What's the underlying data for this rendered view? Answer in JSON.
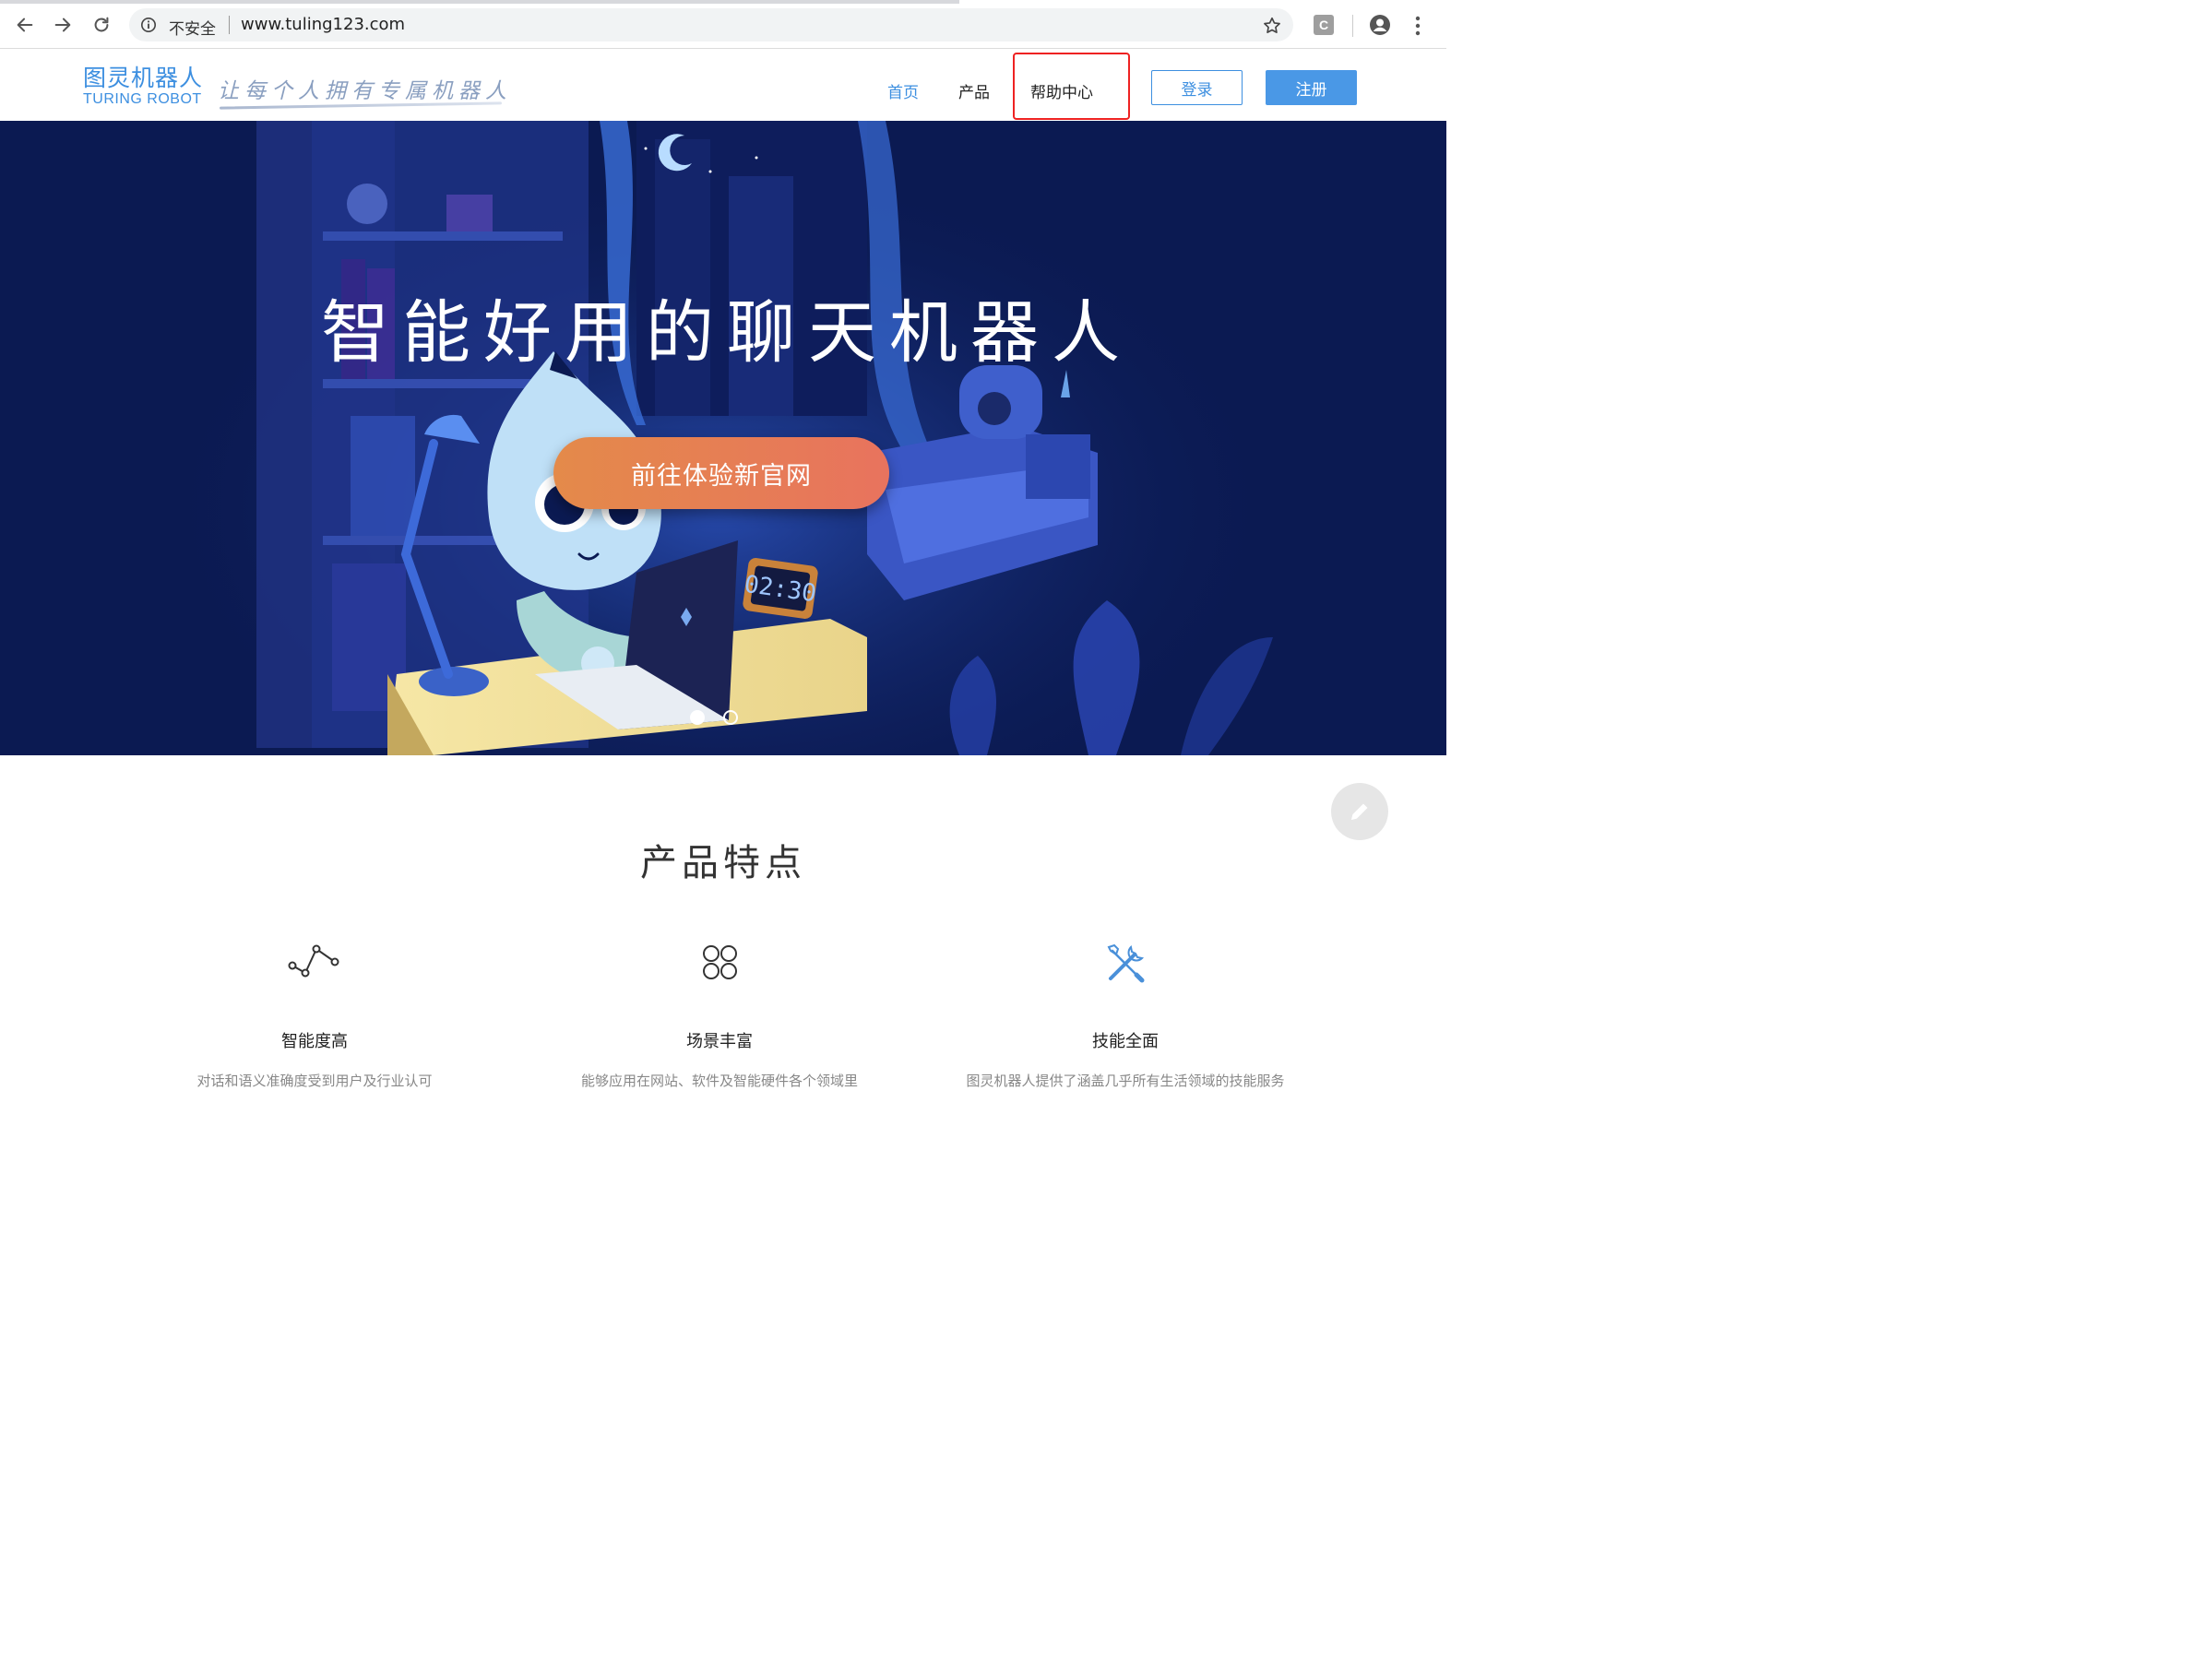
{
  "browser": {
    "security_label": "不安全",
    "url": "www.tuling123.com",
    "extension_letter": "C"
  },
  "header": {
    "logo_cn": "图灵机器人",
    "logo_en": "TURING ROBOT",
    "slogan": "让每个人拥有专属机器人",
    "nav": {
      "home": "首页",
      "product": "产品",
      "help": "帮助中心"
    },
    "login": "登录",
    "register": "注册",
    "accent_color": "#3d8fe0"
  },
  "hero": {
    "title": "智能好用的聊天机器人",
    "cta": "前往体验新官网",
    "clock": "02:30",
    "carousel_count": 2,
    "carousel_active": 1
  },
  "features": {
    "title": "产品特点",
    "items": [
      {
        "icon": "line-chart-icon",
        "name": "智能度高",
        "desc": "对话和语义准确度受到用户及行业认可"
      },
      {
        "icon": "grid-circles-icon",
        "name": "场景丰富",
        "desc": "能够应用在网站、软件及智能硬件各个领域里"
      },
      {
        "icon": "tools-icon",
        "name": "技能全面",
        "desc": "图灵机器人提供了涵盖几乎所有生活领域的技能服务"
      }
    ]
  }
}
